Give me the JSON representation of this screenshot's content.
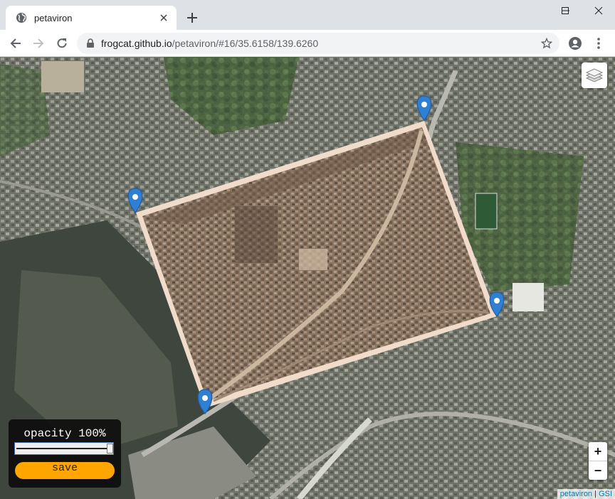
{
  "browser": {
    "tab_title": "petaviron",
    "url_host": "frogcat.github.io",
    "url_path": "/petaviron/#16/35.6158/139.6260"
  },
  "map": {
    "layer_icon": "layers-icon",
    "zoom_in_label": "+",
    "zoom_out_label": "−",
    "attribution_link": "petaviron",
    "attribution_separator": "|",
    "attribution_source": "GSI",
    "overlay_frame_color": "#eed2bd",
    "marker_color": "#2f7fd3",
    "marker_icon": "map-pin-icon"
  },
  "panel": {
    "opacity_label": "opacity 100%",
    "opacity_value": 1.0,
    "save_label": "save",
    "save_color": "#ffa500"
  }
}
